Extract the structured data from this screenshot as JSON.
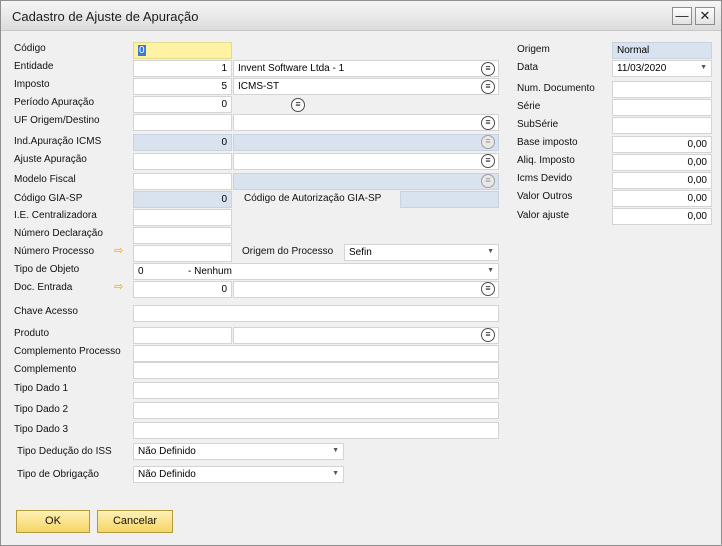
{
  "window": {
    "title": "Cadastro de Ajuste de Apuração",
    "minimize": "—",
    "close": "✕"
  },
  "left": {
    "codigo": {
      "label": "Código",
      "value": "0"
    },
    "entidade": {
      "label": "Entidade",
      "value": "1",
      "desc": "Invent Software Ltda - 1"
    },
    "imposto": {
      "label": "Imposto",
      "value": "5",
      "desc": "ICMS-ST"
    },
    "periodo": {
      "label": "Período Apuração",
      "value": "0"
    },
    "uf": {
      "label": "UF Origem/Destino",
      "value": "",
      "desc": ""
    },
    "ind_apuracao": {
      "label": "Ind.Apuração ICMS",
      "value": "0",
      "desc": ""
    },
    "ajuste": {
      "label": "Ajuste Apuração",
      "value": "",
      "desc": ""
    },
    "modelo_fiscal": {
      "label": "Modelo Fiscal",
      "value": "",
      "desc": ""
    },
    "codigo_gia": {
      "label": "Código GIA-SP",
      "value": "0"
    },
    "cod_autorizacao": {
      "label": "Código de Autorização GIA-SP",
      "value": ""
    },
    "ie_centralizadora": {
      "label": "I.E. Centralizadora",
      "value": ""
    },
    "numero_declaracao": {
      "label": "Número Declaração",
      "value": ""
    },
    "numero_processo": {
      "label": "Número Processo",
      "value": ""
    },
    "origem_processo": {
      "label": "Origem do Processo",
      "value": "Sefin"
    },
    "tipo_objeto": {
      "label": "Tipo de Objeto",
      "value": "0",
      "desc": "- Nenhum"
    },
    "doc_entrada": {
      "label": "Doc. Entrada",
      "value": "0",
      "desc": ""
    },
    "chave_acesso": {
      "label": "Chave Acesso",
      "value": ""
    },
    "produto": {
      "label": "Produto",
      "value": "",
      "desc": ""
    },
    "complemento_processo": {
      "label": "Complemento Processo",
      "value": ""
    },
    "complemento": {
      "label": "Complemento",
      "value": ""
    },
    "tipo_dado_1": {
      "label": "Tipo Dado 1",
      "value": ""
    },
    "tipo_dado_2": {
      "label": "Tipo Dado 2",
      "value": ""
    },
    "tipo_dado_3": {
      "label": "Tipo Dado 3",
      "value": ""
    },
    "tipo_deducao": {
      "label": "Tipo Dedução do ISS",
      "value": "Não Definido"
    },
    "tipo_obrigacao": {
      "label": "Tipo de Obrigação",
      "value": "Não Definido"
    }
  },
  "right": {
    "origem": {
      "label": "Origem",
      "value": "Normal"
    },
    "data": {
      "label": "Data",
      "value": "11/03/2020"
    },
    "num_documento": {
      "label": "Num. Documento",
      "value": ""
    },
    "serie": {
      "label": "Série",
      "value": ""
    },
    "subserie": {
      "label": "SubSérie",
      "value": ""
    },
    "base_imposto": {
      "label": "Base imposto",
      "value": "0,00"
    },
    "aliq_imposto": {
      "label": "Aliq. Imposto",
      "value": "0,00"
    },
    "icms_devido": {
      "label": "Icms Devido",
      "value": "0,00"
    },
    "valor_outros": {
      "label": "Valor Outros",
      "value": "0,00"
    },
    "valor_ajuste": {
      "label": "Valor ajuste",
      "value": "0,00"
    }
  },
  "buttons": {
    "ok": "OK",
    "cancel": "Cancelar"
  },
  "icons": {
    "list": "≡",
    "link_arrow": "⇨"
  }
}
